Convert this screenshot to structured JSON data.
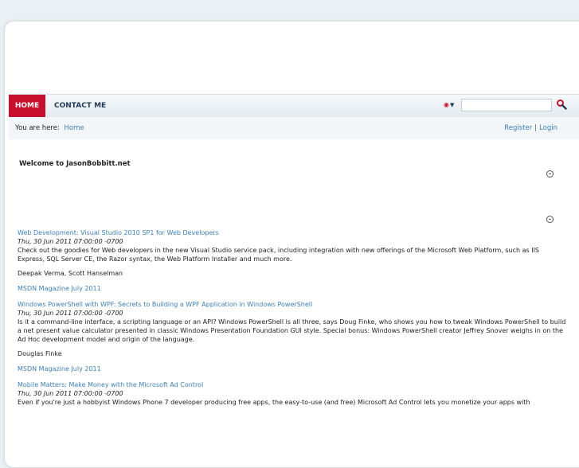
{
  "nav": {
    "home": "HOME",
    "contact": "CONTACT ME"
  },
  "search": {
    "placeholder": "",
    "language_icon": "language-flag-icon"
  },
  "breadcrumb": {
    "label": "You are here:",
    "home": "Home"
  },
  "auth": {
    "register": "Register",
    "separator": "|",
    "login": "Login"
  },
  "welcome": "Welcome to JasonBobbitt.net",
  "feed": [
    {
      "title": "Web Development: Visual Studio 2010 SP1 for Web Developers",
      "date": "Thu, 30 Jun 2011 07:00:00 -0700",
      "desc": "Check out the goodies for Web developers in the new Visual Studio service pack, including integration with new offerings of the Microsoft Web Platform, such as IIS Express, SQL Server CE, the Razor syntax, the Web Platform Installer and much more.",
      "authors": "Deepak Verma, Scott Hanselman",
      "source": "MSDN Magazine July 2011"
    },
    {
      "title": "Windows PowerShell with WPF: Secrets to Building a WPF Application in Windows PowerShell",
      "date": "Thu, 30 Jun 2011 07:00:00 -0700",
      "desc": "Is it a command-line interface, a scripting language or an API? Windows PowerShell is all three, says Doug Finke, who shows you how to tweak Windows PowerShell to build a net present value calculator presented in classic Windows Presentation Foundation GUI style. Special bonus: Windows PowerShell creator Jeffrey Snover weighs in on the Ad Hoc development model and origin of the language.",
      "authors": "Douglas Finke",
      "source": "MSDN Magazine July 2011"
    },
    {
      "title": "Mobile Matters: Make Money with the Microsoft Ad Control",
      "date": "Thu, 30 Jun 2011 07:00:00 -0700",
      "desc": "Even if you're just a hobbyist Windows Phone 7 developer producing free apps, the easy-to-use (and free) Microsoft Ad Control lets you monetize your apps with",
      "authors": "",
      "source": ""
    }
  ]
}
